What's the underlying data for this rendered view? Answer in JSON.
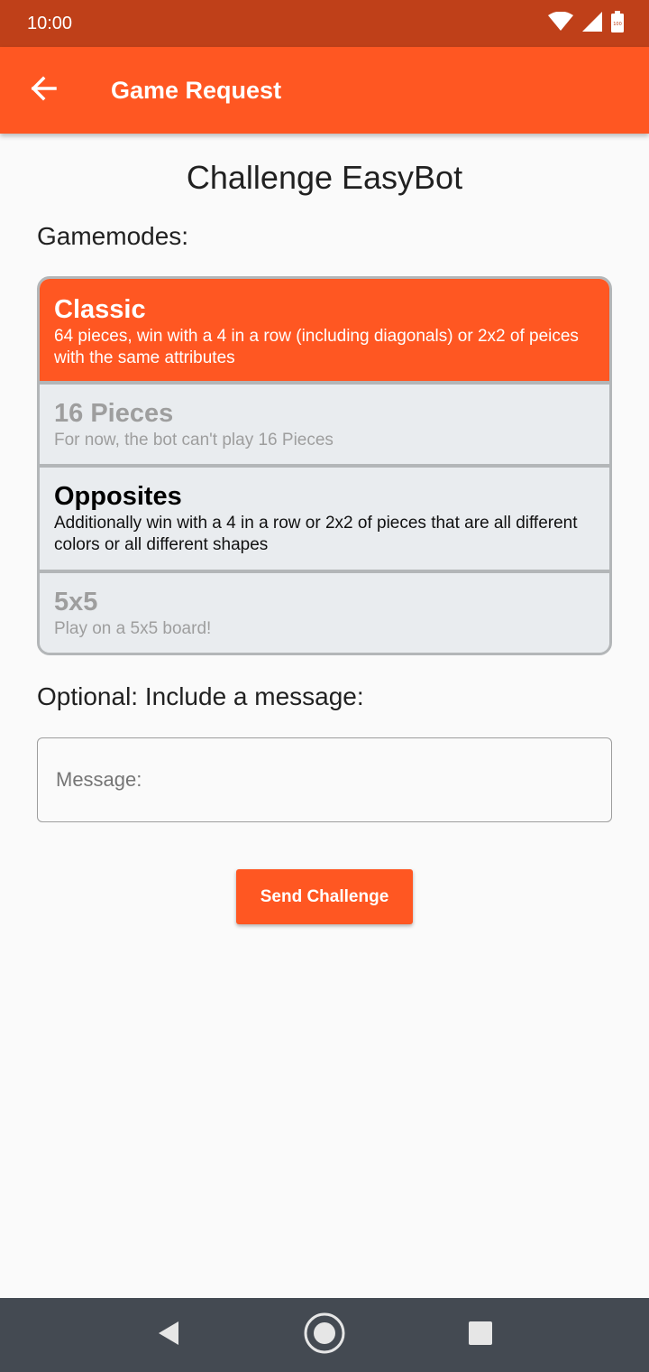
{
  "status_bar": {
    "time": "10:00",
    "icons": [
      "wifi-icon",
      "signal-icon",
      "battery-icon"
    ],
    "battery_label": "100"
  },
  "app_bar": {
    "back_icon": "arrow-back-icon",
    "title": "Game Request"
  },
  "page": {
    "heading": "Challenge EasyBot",
    "gamemodes_label": "Gamemodes:",
    "message_label": "Optional: Include a message:"
  },
  "gamemodes": [
    {
      "title": "Classic",
      "description": "64 pieces, win with a 4 in a row (including diagonals) or 2x2 of peices with the same attributes",
      "state": "selected"
    },
    {
      "title": "16 Pieces",
      "description": "For now, the bot can't play 16 Pieces",
      "state": "disabled"
    },
    {
      "title": "Opposites",
      "description": "Additionally win with a 4 in a row or 2x2 of pieces that are all different colors or all different shapes",
      "state": "enabled"
    },
    {
      "title": "5x5",
      "description": "Play on a 5x5 board!",
      "state": "disabled"
    }
  ],
  "message_input": {
    "placeholder": "Message:",
    "value": ""
  },
  "send_button": {
    "label": "Send Challenge"
  },
  "nav_bar": {
    "icons": [
      "back-triangle-icon",
      "home-circle-icon",
      "recents-square-icon"
    ]
  },
  "colors": {
    "primary": "#ff5722",
    "primary_dark": "#bf4019",
    "mode_background": "#e9ecef",
    "nav_bar": "#444a52"
  }
}
